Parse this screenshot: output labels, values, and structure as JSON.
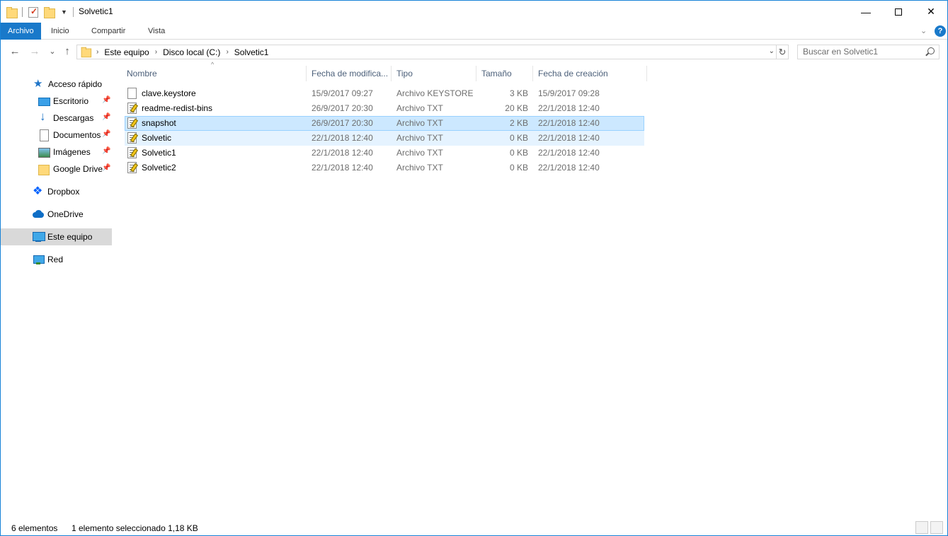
{
  "window": {
    "title": "Solvetic1",
    "minimize_glyph": "—",
    "close_glyph": "✕"
  },
  "ribbon": {
    "tabs": [
      "Archivo",
      "Inicio",
      "Compartir",
      "Vista"
    ],
    "expand_glyph": "⌄",
    "help_glyph": "?"
  },
  "address": {
    "crumbs": [
      "Este equipo",
      "Disco local (C:)",
      "Solvetic1"
    ],
    "separator": "›",
    "dropdown_glyph": "⌄",
    "refresh_glyph": "↻",
    "back_glyph": "←",
    "forward_glyph": "→",
    "recent_glyph": "⌄",
    "up_glyph": "↑"
  },
  "search": {
    "placeholder": "Buscar en Solvetic1"
  },
  "sidebar": {
    "pin_glyph": "📌",
    "items": [
      {
        "label": "Acceso rápido",
        "icon": "quick-access-icon"
      },
      {
        "label": "Escritorio",
        "icon": "desktop-icon",
        "pinned": true
      },
      {
        "label": "Descargas",
        "icon": "downloads-icon",
        "pinned": true
      },
      {
        "label": "Documentos",
        "icon": "documents-icon",
        "pinned": true
      },
      {
        "label": "Imágenes",
        "icon": "pictures-icon",
        "pinned": true
      },
      {
        "label": "Google Drive",
        "icon": "folder-icon",
        "pinned": true
      },
      {
        "label": "Dropbox",
        "icon": "dropbox-icon"
      },
      {
        "label": "OneDrive",
        "icon": "onedrive-icon"
      },
      {
        "label": "Este equipo",
        "icon": "this-pc-icon",
        "selected": true
      },
      {
        "label": "Red",
        "icon": "network-icon"
      }
    ]
  },
  "table": {
    "sort_glyph": "^",
    "columns": [
      "Nombre",
      "Fecha de modifica...",
      "Tipo",
      "Tamaño",
      "Fecha de creación"
    ],
    "rows": [
      {
        "name": "clave.keystore",
        "modified": "15/9/2017 09:27",
        "type": "Archivo KEYSTORE",
        "size": "3 KB",
        "created": "15/9/2017 09:28",
        "icon": "file-icon"
      },
      {
        "name": "readme-redist-bins",
        "modified": "26/9/2017 20:30",
        "type": "Archivo TXT",
        "size": "20 KB",
        "created": "22/1/2018 12:40",
        "icon": "text-file-icon"
      },
      {
        "name": "snapshot",
        "modified": "26/9/2017 20:30",
        "type": "Archivo TXT",
        "size": "2 KB",
        "created": "22/1/2018 12:40",
        "icon": "text-file-icon",
        "selected": true
      },
      {
        "name": "Solvetic",
        "modified": "22/1/2018 12:40",
        "type": "Archivo TXT",
        "size": "0 KB",
        "created": "22/1/2018 12:40",
        "icon": "text-file-icon",
        "hover": true
      },
      {
        "name": "Solvetic1",
        "modified": "22/1/2018 12:40",
        "type": "Archivo TXT",
        "size": "0 KB",
        "created": "22/1/2018 12:40",
        "icon": "text-file-icon"
      },
      {
        "name": "Solvetic2",
        "modified": "22/1/2018 12:40",
        "type": "Archivo TXT",
        "size": "0 KB",
        "created": "22/1/2018 12:40",
        "icon": "text-file-icon"
      }
    ]
  },
  "status": {
    "count": "6 elementos",
    "selection": "1 elemento seleccionado  1,18 KB"
  }
}
